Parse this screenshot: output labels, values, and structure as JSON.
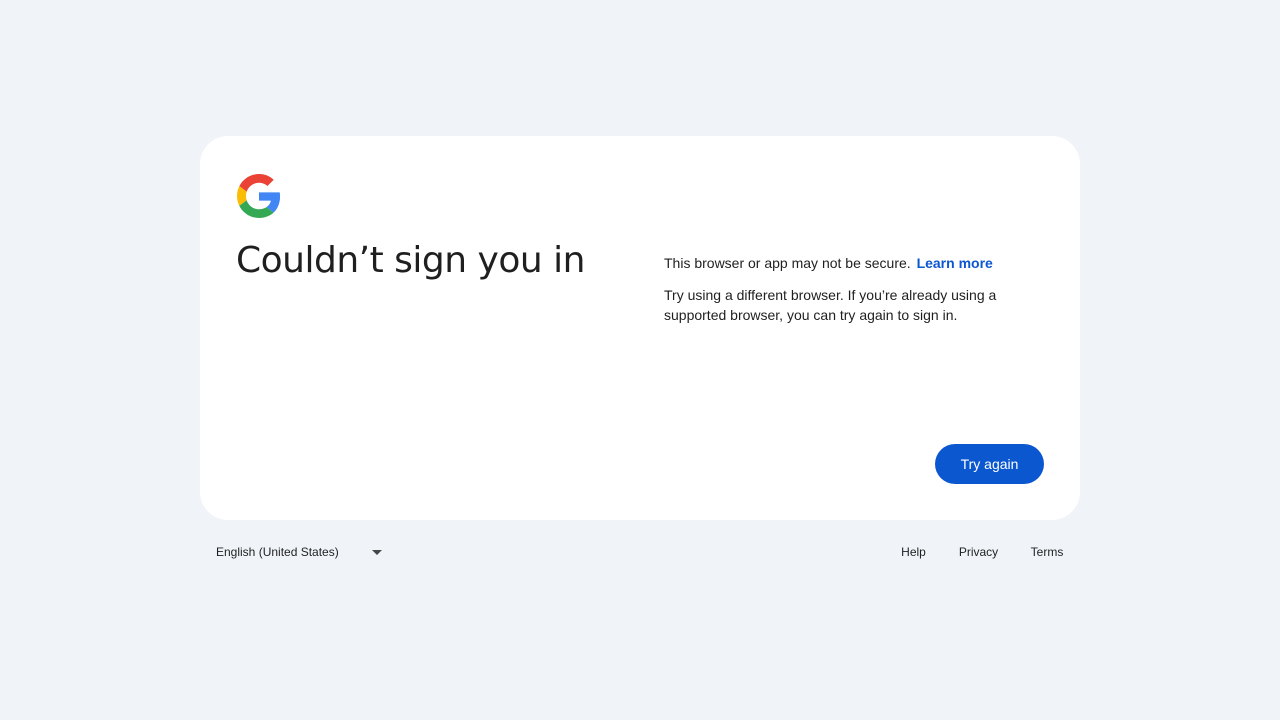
{
  "card": {
    "heading": "Couldn’t sign you in",
    "message_line1": "This browser or app may not be secure.",
    "learn_more": "Learn more",
    "message_line2": "Try using a different browser. If you’re already using a supported browser, you can try again to sign in.",
    "try_again": "Try again"
  },
  "footer": {
    "language": "English (United States)",
    "help": "Help",
    "privacy": "Privacy",
    "terms": "Terms"
  },
  "icons": {
    "logo": "google-g-logo",
    "language_dropdown": "caret-down-icon"
  },
  "colors": {
    "background": "#f0f4f9",
    "card": "#ffffff",
    "accent": "#0b57d0",
    "google_blue": "#4285F4",
    "google_red": "#EA4335",
    "google_yellow": "#FBBC05",
    "google_green": "#34A853"
  }
}
